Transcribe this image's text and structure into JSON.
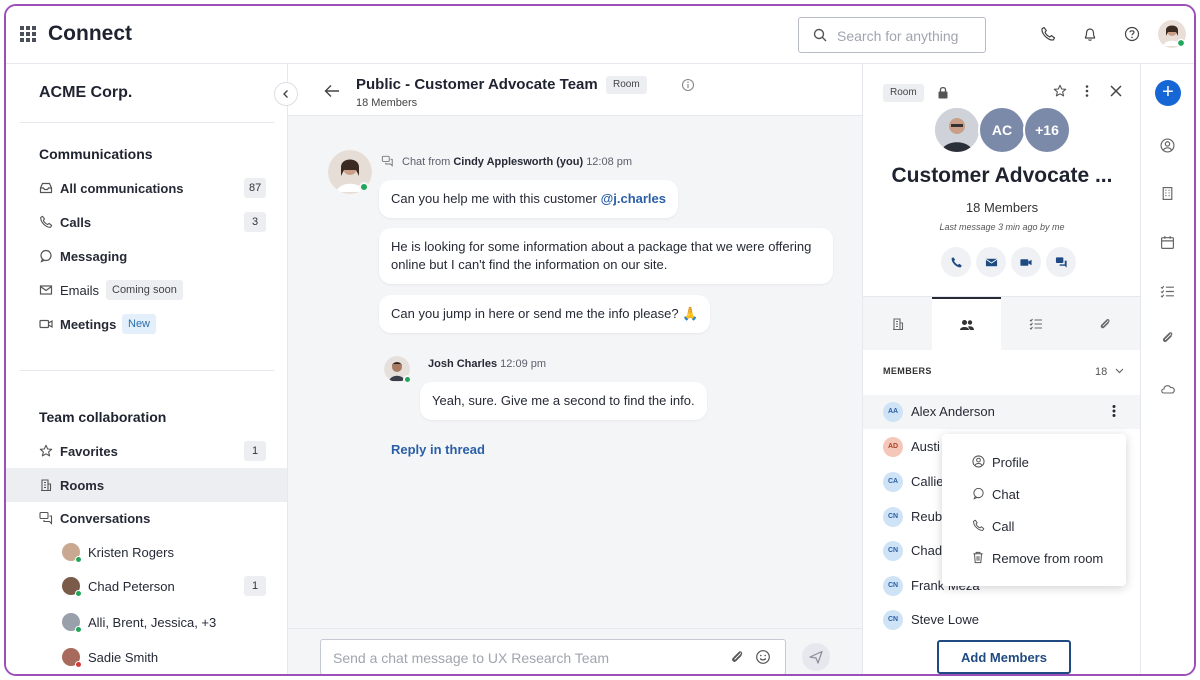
{
  "app": {
    "title": "Connect"
  },
  "search": {
    "placeholder": "Search for anything"
  },
  "sidebar": {
    "org": "ACME Corp.",
    "communications_title": "Communications",
    "communications": [
      {
        "label": "All communications",
        "badge": "87",
        "icon": "inbox-icon"
      },
      {
        "label": "Calls",
        "badge": "3",
        "icon": "phone-icon"
      },
      {
        "label": "Messaging",
        "badge": "",
        "icon": "message-icon"
      },
      {
        "label": "Emails",
        "tag": "Coming soon",
        "icon": "email-icon"
      },
      {
        "label": "Meetings",
        "tag": "New",
        "icon": "video-icon"
      }
    ],
    "team_title": "Team collaboration",
    "team": [
      {
        "label": "Favorites",
        "badge": "1",
        "icon": "star-icon"
      },
      {
        "label": "Rooms",
        "badge": "",
        "icon": "building-icon"
      },
      {
        "label": "Conversations",
        "badge": "",
        "icon": "conversation-icon"
      }
    ],
    "conversations": [
      {
        "name": "Kristen Rogers",
        "badge": "",
        "presence": "#23a55a",
        "avatar_color": "#c9a892"
      },
      {
        "name": "Chad Peterson",
        "badge": "1",
        "presence": "#23a55a",
        "avatar_color": "#7a5a48"
      },
      {
        "name": "Alli, Brent, Jessica, +3",
        "badge": "",
        "presence": "#23a55a",
        "avatar_color": "#9aa0aa"
      },
      {
        "name": "Sadie Smith",
        "badge": "",
        "presence": "#d33a3a",
        "avatar_color": "#a86a5c"
      }
    ]
  },
  "chat": {
    "title": "Public - Customer Advocate Team",
    "tag": "Room",
    "subtitle": "18 Members",
    "messages": {
      "first_meta_prefix": "Chat from",
      "first_sender": "Cindy Applesworth (you)",
      "first_time": "12:08 pm",
      "bubble1_text": "Can you help me with this customer",
      "bubble1_mention": "@j.charles",
      "bubble2_text": "He is looking for some information about a package that we were offering online but I can't find the information on our site.",
      "bubble3_text": "Can you jump in here or send me the info please? 🙏",
      "reply_sender": "Josh Charles",
      "reply_time": "12:09 pm",
      "reply_text": "Yeah, sure. Give me a second to find the info.",
      "reply_link": "Reply in thread"
    },
    "composer_placeholder": "Send a chat message to UX Research Team"
  },
  "room_panel": {
    "tag": "Room",
    "avatar_ac": "AC",
    "avatar_more": "+16",
    "title": "Customer Advocate ...",
    "members_text": "18 Members",
    "last_message": "Last message 3 min ago by me",
    "members_header": "MEMBERS",
    "members_count": "18",
    "members": [
      {
        "initials": "AA",
        "name": "Alex Anderson",
        "bg": "#cfe3f6",
        "fg": "#2a5fa8"
      },
      {
        "initials": "AD",
        "name": "Austi",
        "bg": "#f5c7b8",
        "fg": "#a8442a"
      },
      {
        "initials": "CA",
        "name": "Callie",
        "bg": "#cfe3f6",
        "fg": "#2a5fa8"
      },
      {
        "initials": "CN",
        "name": "Reube",
        "bg": "#cfe3f6",
        "fg": "#2a5fa8"
      },
      {
        "initials": "CN",
        "name": "Chad",
        "bg": "#cfe3f6",
        "fg": "#2a5fa8"
      },
      {
        "initials": "CN",
        "name": "Frank Meza",
        "bg": "#cfe3f6",
        "fg": "#2a5fa8"
      },
      {
        "initials": "CN",
        "name": "Steve Lowe",
        "bg": "#cfe3f6",
        "fg": "#2a5fa8"
      }
    ],
    "add_members": "Add Members"
  },
  "context_menu": {
    "items": [
      {
        "label": "Profile",
        "icon": "profile-icon"
      },
      {
        "label": "Chat",
        "icon": "chat-icon"
      },
      {
        "label": "Call",
        "icon": "phone-icon"
      },
      {
        "label": "Remove from room",
        "icon": "trash-icon"
      }
    ]
  },
  "colors": {
    "accent": "#1766d6",
    "link": "#2a5fa8",
    "frame": "#9b4fb8",
    "online": "#23a55a",
    "busy": "#d33a3a"
  }
}
